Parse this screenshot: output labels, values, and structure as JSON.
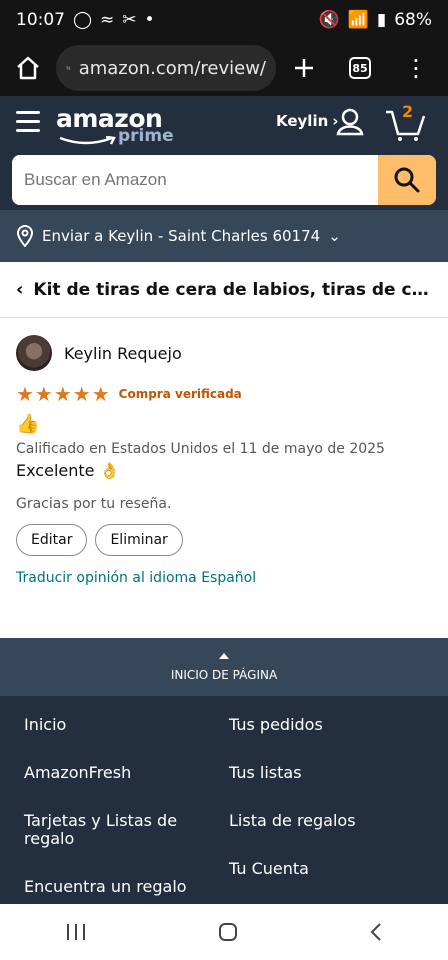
{
  "status": {
    "time": "10:07",
    "battery": "68%",
    "left_icons": [
      "whatsapp-icon",
      "wave-icon",
      "scissors-icon",
      "dot-icon"
    ],
    "right_icons": [
      "mute-icon",
      "wifi-icon",
      "signal-icon"
    ]
  },
  "browser": {
    "url": "amazon.com/review/",
    "tabs_count": "85"
  },
  "header": {
    "logo_main": "amazon",
    "logo_sub": "prime",
    "account_name": "Keylin",
    "cart_count": "2"
  },
  "search": {
    "placeholder": "Buscar en Amazon"
  },
  "delivery": {
    "text": "Enviar a Keylin - Saint Charles 60174"
  },
  "product": {
    "title": "Kit de tiras de cera de labios, tiras de cera faci…"
  },
  "review": {
    "reviewer_name": "Keylin Requejo",
    "stars": 5,
    "stars_label": "★★★★★",
    "verified": "Compra verificada",
    "emoji": "👍",
    "date": "Calificado en Estados Unidos el 11 de mayo de 2025",
    "headline": "Excelente 👌",
    "thanks": "Gracias por tu reseña.",
    "edit_label": "Editar",
    "delete_label": "Eliminar",
    "translate": "Traducir opinión al idioma Español"
  },
  "back_to_top": {
    "label": "INICIO DE PÁGINA"
  },
  "footer": {
    "col1": [
      "Inicio",
      "AmazonFresh",
      "Tarjetas y Listas de regalo",
      "Encuentra un regalo"
    ],
    "col2": [
      "Tus pedidos",
      "Tus listas",
      "Lista de regalos",
      "Tu Cuenta"
    ]
  },
  "nav": {
    "icons": [
      "recents-icon",
      "home-icon",
      "back-icon"
    ]
  },
  "colors": {
    "amazon_dark": "#232f3e",
    "amazon_mid": "#37475a",
    "star": "#de7921",
    "link": "#007185",
    "search_button": "#febd69"
  }
}
